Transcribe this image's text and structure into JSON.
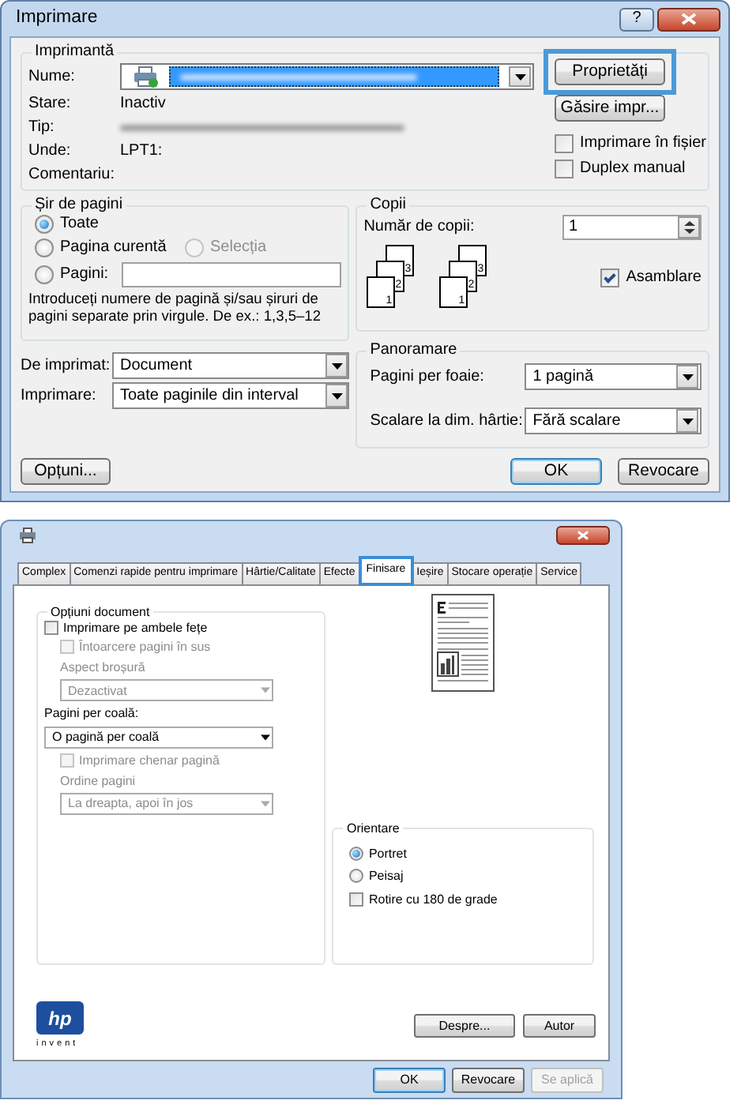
{
  "print_dialog": {
    "title": "Imprimare",
    "help_button": "?",
    "printer": {
      "group_label": "Imprimantă",
      "fields": [
        {
          "label": "Nume:",
          "kind": "printer_combo"
        },
        {
          "label": "Stare:",
          "kind": "text",
          "value": "Inactiv"
        },
        {
          "label": "Tip:",
          "kind": "redacted"
        },
        {
          "label": "Unde:",
          "kind": "text",
          "value": "LPT1:"
        },
        {
          "label": "Comentariu:",
          "kind": "text"
        }
      ],
      "buttons": [
        {
          "label": "Proprietăți",
          "highlighted": true
        },
        {
          "label": "Găsire impr...",
          "highlighted": false
        }
      ],
      "options": [
        {
          "label": "Imprimare în fișier",
          "checked": false
        },
        {
          "label": "Duplex manual",
          "checked": false
        }
      ]
    },
    "page_range": {
      "group_label": "Șir de pagini",
      "options": [
        {
          "label": "Toate",
          "selected": true,
          "disabled": false
        },
        {
          "label": "Pagina curentă",
          "selected": false,
          "disabled": false
        },
        {
          "label": "Selecția",
          "selected": false,
          "disabled": true
        },
        {
          "label": "Pagini:",
          "selected": false,
          "disabled": false
        }
      ],
      "hint": "Introduceți numere de pagină și/sau șiruri de pagini separate prin virgule.  De ex.: 1,3,5–12"
    },
    "copies": {
      "group_label": "Copii",
      "count_label": "Număr de copii:",
      "count": "1",
      "stacks": [
        [
          "3",
          "2",
          "1"
        ],
        [
          "3",
          "2",
          "1"
        ]
      ],
      "collate": {
        "label": "Asamblare",
        "checked": true
      }
    },
    "print_what": [
      {
        "label": "De imprimat:",
        "value": "Document"
      },
      {
        "label": "Imprimare:",
        "value": "Toate paginile din interval"
      }
    ],
    "zoom": {
      "group_label": "Panoramare",
      "fields": [
        {
          "label": "Pagini per foaie:",
          "value": "1 pagină"
        },
        {
          "label": "Scalare la dim. hârtie:",
          "value": "Fără scalare"
        }
      ]
    },
    "options_button": "Opțuni...",
    "buttons": [
      {
        "label": "OK",
        "default": true,
        "disabled": false
      },
      {
        "label": "Revocare",
        "default": false,
        "disabled": false
      }
    ]
  },
  "properties_dialog": {
    "tabs": [
      {
        "label": "Complex",
        "selected": false,
        "highlighted": false
      },
      {
        "label": "Comenzi rapide pentru imprimare",
        "selected": false,
        "highlighted": false
      },
      {
        "label": "Hârtie/Calitate",
        "selected": false,
        "highlighted": false
      },
      {
        "label": "Efecte",
        "selected": false,
        "highlighted": false
      },
      {
        "label": "Finisare",
        "selected": true,
        "highlighted": true
      },
      {
        "label": "Ieșire",
        "selected": false,
        "highlighted": false
      },
      {
        "label": "Stocare operație",
        "selected": false,
        "highlighted": false
      },
      {
        "label": "Service",
        "selected": false,
        "highlighted": false
      }
    ],
    "document_options": {
      "group_label": "Opțiuni document",
      "items": [
        {
          "kind": "checkbox",
          "label": "Imprimare pe ambele fețe",
          "checked": false,
          "disabled": false,
          "children": [
            {
              "kind": "checkbox",
              "label": "Întoarcere pagini în sus",
              "checked": false,
              "disabled": true
            },
            {
              "kind": "label",
              "label": "Aspect broșură",
              "disabled": true
            },
            {
              "kind": "dropdown",
              "value": "Dezactivat",
              "disabled": true
            }
          ]
        },
        {
          "kind": "label",
          "label": "Pagini per coală:",
          "disabled": false
        },
        {
          "kind": "dropdown",
          "value": "O pagină per coală",
          "disabled": false,
          "children": [
            {
              "kind": "checkbox",
              "label": "Imprimare chenar pagină",
              "checked": false,
              "disabled": true
            },
            {
              "kind": "label",
              "label": "Ordine pagini",
              "disabled": true
            },
            {
              "kind": "dropdown",
              "value": "La dreapta, apoi în jos",
              "disabled": true
            }
          ]
        }
      ]
    },
    "orientation": {
      "group_label": "Orientare",
      "items": [
        {
          "kind": "radio",
          "label": "Portret",
          "selected": true
        },
        {
          "kind": "radio",
          "label": "Peisaj",
          "selected": false
        },
        {
          "kind": "checkbox",
          "label": "Rotire cu 180 de grade",
          "checked": false
        }
      ]
    },
    "logo": {
      "text": "hp",
      "tagline": "invent"
    },
    "panel_buttons": [
      "Despre...",
      "Autor"
    ],
    "buttons": [
      {
        "label": "OK",
        "default": true,
        "disabled": false
      },
      {
        "label": "Revocare",
        "default": false,
        "disabled": false
      },
      {
        "label": "Se aplică",
        "default": false,
        "disabled": true
      }
    ]
  }
}
